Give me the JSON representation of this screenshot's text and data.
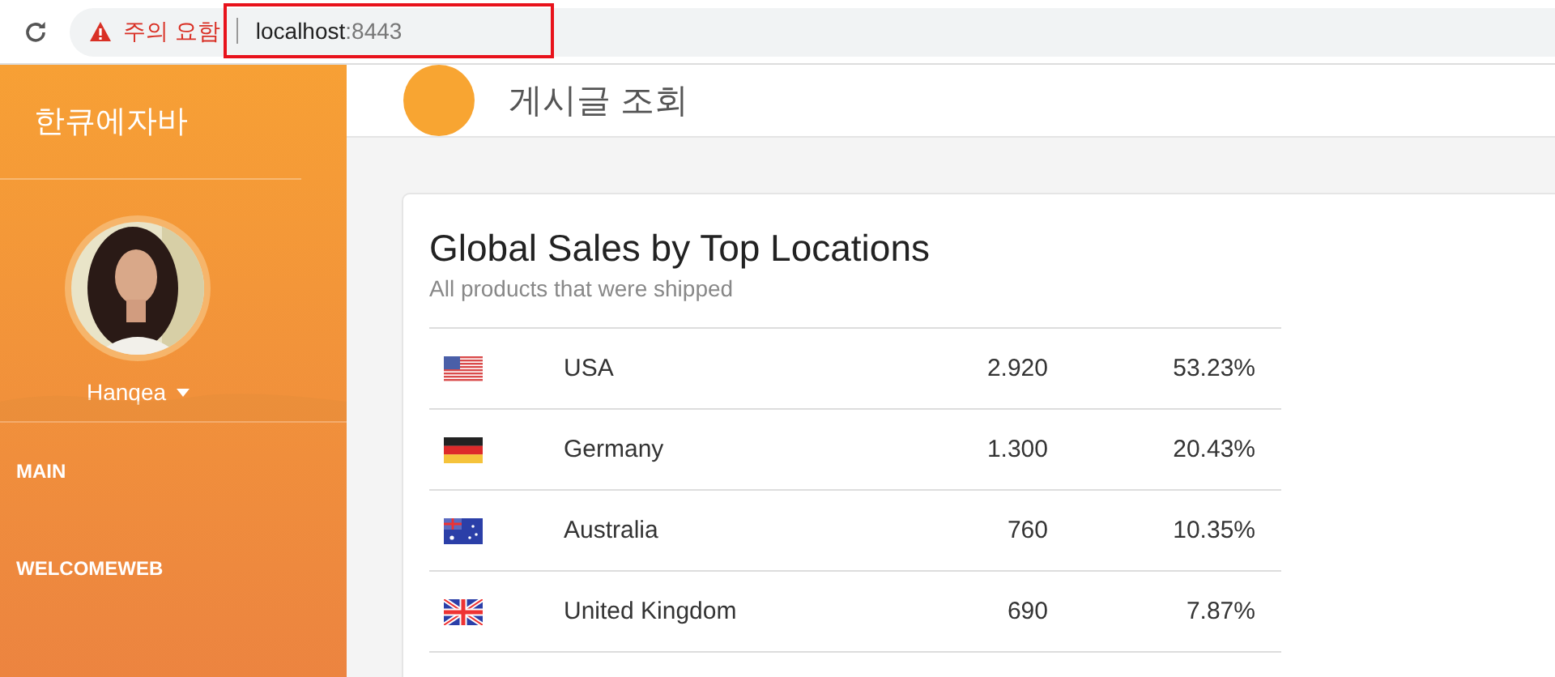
{
  "browser": {
    "warning": "주의 요함",
    "url_host": "localhost",
    "url_port": ":8443"
  },
  "sidebar": {
    "brand": "한큐에자바",
    "user": {
      "name": "Hanqea"
    },
    "items": [
      {
        "label": "MAIN"
      },
      {
        "label": "WELCOMEWEB"
      }
    ]
  },
  "header": {
    "title": "게시글 조회"
  },
  "card": {
    "title": "Global Sales by Top Locations",
    "subtitle": "All products that were shipped",
    "rows": [
      {
        "country": "USA",
        "sales": "2.920",
        "share": "53.23%"
      },
      {
        "country": "Germany",
        "sales": "1.300",
        "share": "20.43%"
      },
      {
        "country": "Australia",
        "sales": "760",
        "share": "10.35%"
      },
      {
        "country": "United Kingdom",
        "sales": "690",
        "share": "7.87%"
      }
    ]
  }
}
